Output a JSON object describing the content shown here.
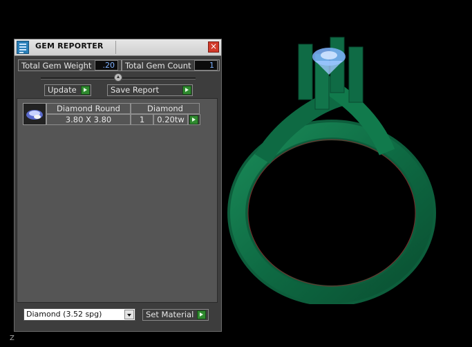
{
  "panel": {
    "title": "GEM REPORTER",
    "close_glyph": "×",
    "total_weight_label": "Total Gem Weight",
    "total_weight_value": ".20",
    "total_count_label": "Total Gem Count",
    "total_count_value": "1",
    "update_label": "Update",
    "save_report_label": "Save Report"
  },
  "gem_rows": [
    {
      "shape": "Diamond Round",
      "size": "3.80 X 3.80",
      "material": "Diamond",
      "count": "1",
      "weight": "0.20tw"
    }
  ],
  "material_select": {
    "value": "Diamond     (3.52 spg)"
  },
  "set_material_label": "Set Material",
  "axis": {
    "label": "Z"
  },
  "colors": {
    "ring": "#0f6b45",
    "gem": "#7fb4ff",
    "panel_bg": "#3d3d3d",
    "go_button": "#2f8a2f"
  },
  "icons": [
    "gem-reporter-icon",
    "close-icon",
    "play-arrow-icon",
    "dropdown-arrow-icon",
    "round-gem-icon"
  ]
}
